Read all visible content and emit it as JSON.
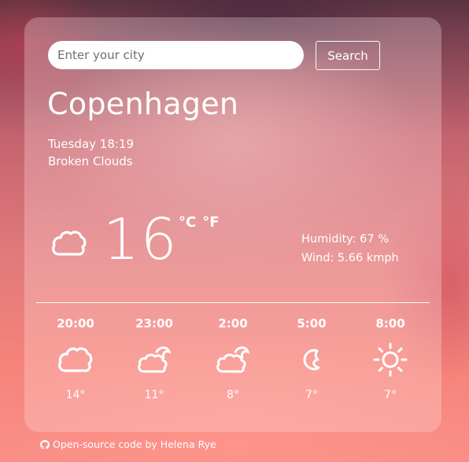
{
  "search": {
    "placeholder": "Enter your city",
    "value": "",
    "button_label": "Search"
  },
  "current": {
    "city": "Copenhagen",
    "date": "Tuesday 18:19",
    "description": "Broken Clouds",
    "icon": "cloud-icon",
    "temperature": "16",
    "unit_celsius": "°C",
    "unit_fahrenheit": "°F",
    "humidity": "Humidity: 67 %",
    "wind": "Wind: 5.66 kmph"
  },
  "forecast": [
    {
      "time": "20:00",
      "icon": "cloud-icon",
      "temp": "14°"
    },
    {
      "time": "23:00",
      "icon": "cloud-moon-icon",
      "temp": "11°"
    },
    {
      "time": "2:00",
      "icon": "cloud-moon-icon",
      "temp": "8°"
    },
    {
      "time": "5:00",
      "icon": "moon-icon",
      "temp": "7°"
    },
    {
      "time": "8:00",
      "icon": "sun-icon",
      "temp": "7°"
    }
  ],
  "footer": {
    "icon": "github-icon",
    "text": "Open-source code by Helena Rye"
  }
}
